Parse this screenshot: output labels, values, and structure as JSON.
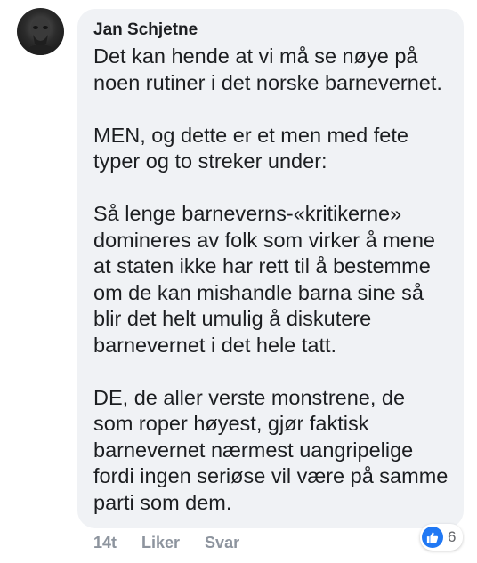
{
  "comment": {
    "author": "Jan Schjetne",
    "paragraphs": [
      "Det kan hende at vi må se nøye på noen rutiner i det norske barnevernet.",
      "MEN, og dette er et men med fete typer og to streker under:",
      "Så lenge barneverns-«kritikerne» domineres av folk som virker å mene at staten ikke har rett til å bestemme om de kan mishandle barna sine så blir det helt umulig å diskutere barnevernet i det hele tatt.",
      "DE, de aller verste monstrene, de som roper høyest, gjør faktisk barnevernet nærmest uangripelige fordi ingen seriøse vil være på samme parti som dem."
    ]
  },
  "actions": {
    "timestamp": "14t",
    "like_label": "Liker",
    "reply_label": "Svar"
  },
  "reactions": {
    "icon": "thumbs-up-icon",
    "count": "6",
    "color": "#2078f4"
  },
  "colors": {
    "bubble": "#f0f2f5",
    "text": "#1c1e21",
    "meta": "#8d949e"
  }
}
